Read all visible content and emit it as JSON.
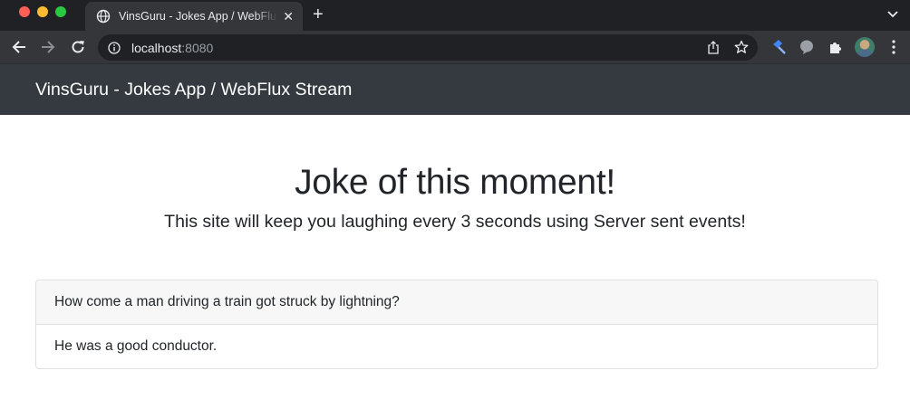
{
  "browser": {
    "tab": {
      "title": "VinsGuru - Jokes App / WebFlux Stream",
      "favicon": "globe-icon"
    },
    "address_bar": {
      "host": "localhost",
      "port": ":8080"
    },
    "colors": {
      "chrome_dark": "#202124",
      "chrome_toolbar": "#35363a",
      "extension_accent": "#4285f4"
    }
  },
  "page": {
    "navbar": {
      "brand": "VinsGuru - Jokes App / WebFlux Stream",
      "background": "#343a40"
    },
    "hero": {
      "title": "Joke of this moment!",
      "subtitle": "This site will keep you laughing every 3 seconds using Server sent events!"
    },
    "joke": {
      "setup": "How come a man driving a train got struck by lightning?",
      "punchline": "He was a good conductor."
    }
  }
}
